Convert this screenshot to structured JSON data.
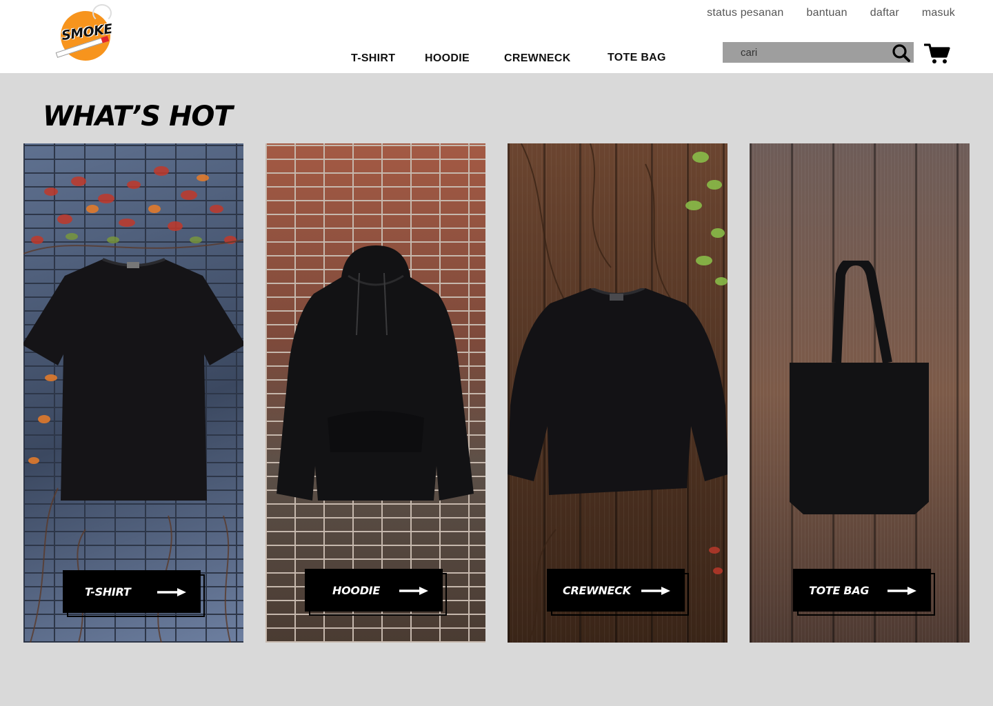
{
  "brand": {
    "logo_text": "SMOKE"
  },
  "top_links": [
    "status pesanan",
    "bantuan",
    "daftar",
    "masuk"
  ],
  "categories": [
    "T-SHIRT",
    "HOODIE",
    "CREWNECK",
    "TOTE BAG"
  ],
  "search": {
    "placeholder": "cari"
  },
  "section": {
    "title": "WHAT’S HOT"
  },
  "cards": [
    {
      "label": "T-SHIRT"
    },
    {
      "label": "HOODIE"
    },
    {
      "label": "CREWNECK"
    },
    {
      "label": "TOTE BAG"
    }
  ],
  "colors": {
    "brand_orange": "#f7941d",
    "header_bg": "#ffffff",
    "page_bg": "#d9d9d9",
    "search_bg": "#9e9e9e"
  },
  "icons": [
    "search-icon",
    "cart-icon",
    "arrow-right-icon"
  ]
}
